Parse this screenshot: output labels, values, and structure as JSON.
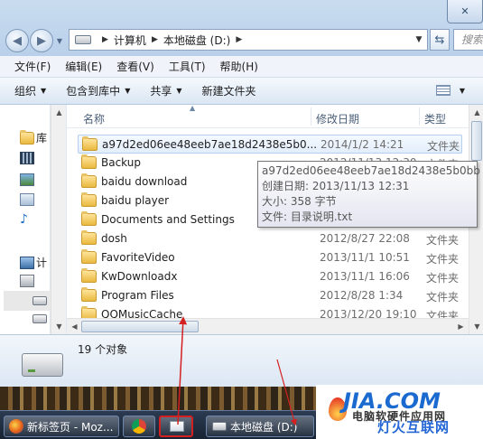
{
  "window": {
    "controls": [
      "✕"
    ]
  },
  "address": {
    "crumbs": [
      "计算机",
      "本地磁盘 (D:)"
    ],
    "search_placeholder": "搜索"
  },
  "menu": [
    "文件(F)",
    "编辑(E)",
    "查看(V)",
    "工具(T)",
    "帮助(H)"
  ],
  "toolbar": {
    "organize": "组织",
    "include_in_library": "包含到库中",
    "share": "共享",
    "new_folder": "新建文件夹"
  },
  "nav_pane": {
    "items": [
      {
        "icon": "folder-icon",
        "label": "库"
      },
      {
        "icon": "video-library-icon",
        "label": ""
      },
      {
        "icon": "picture-library-icon",
        "label": ""
      },
      {
        "icon": "document-library-icon",
        "label": ""
      },
      {
        "icon": "music-library-icon",
        "label": ""
      },
      {
        "icon": "computer-icon",
        "label": "计"
      },
      {
        "icon": "system-drive-icon",
        "label": ""
      },
      {
        "icon": "drive-icon",
        "label": ""
      },
      {
        "icon": "drive-icon",
        "label": ""
      }
    ]
  },
  "columns": {
    "name": "名称",
    "date": "修改日期",
    "type": "类型"
  },
  "files": [
    {
      "name": "a97d2ed06ee48eeb7ae18d2438e5b0...",
      "date": "2014/1/2 14:21",
      "type": "文件夹",
      "selected": true
    },
    {
      "name": "Backup",
      "date": "2012/11/13 12:30",
      "type": "文件夹",
      "selected": false
    },
    {
      "name": "baidu download",
      "date": "",
      "type": "",
      "selected": false
    },
    {
      "name": "baidu player",
      "date": "",
      "type": "",
      "selected": false
    },
    {
      "name": "Documents and Settings",
      "date": "",
      "type": "",
      "selected": false
    },
    {
      "name": "dosh",
      "date": "2012/8/27 22:08",
      "type": "文件夹",
      "selected": false
    },
    {
      "name": "FavoriteVideo",
      "date": "2013/11/1 10:51",
      "type": "文件夹",
      "selected": false
    },
    {
      "name": "KwDownloadx",
      "date": "2013/11/1 16:06",
      "type": "文件夹",
      "selected": false
    },
    {
      "name": "Program Files",
      "date": "2012/8/28 1:34",
      "type": "文件夹",
      "selected": false
    },
    {
      "name": "QQMusicCache",
      "date": "2013/12/20 19:10",
      "type": "文件夹",
      "selected": false
    }
  ],
  "tooltip": {
    "name": "a97d2ed06ee48eeb7ae18d2438e5b0bb",
    "created": "创建日期: 2013/11/13 12:31",
    "size": "大小: 358 字节",
    "files": "文件: 目录说明.txt"
  },
  "details": {
    "count": "19 个对象"
  },
  "taskbar": {
    "items": [
      {
        "icon": "firefox-icon",
        "label": "新标签页 - Moz..."
      },
      {
        "icon": "chrome-icon",
        "label": ""
      },
      {
        "icon": "explorer-icon",
        "label": ""
      },
      {
        "icon": "drive-icon",
        "label": "本地磁盘 (D:)"
      }
    ]
  },
  "watermark": {
    "logo_text": "JIA.COM",
    "line1": "电脑软硬件应用网",
    "line2": "灯火互联网"
  },
  "colors": {
    "annotation": "#d42020",
    "folder": "#e9b93f",
    "selection": "#e3eefb"
  }
}
